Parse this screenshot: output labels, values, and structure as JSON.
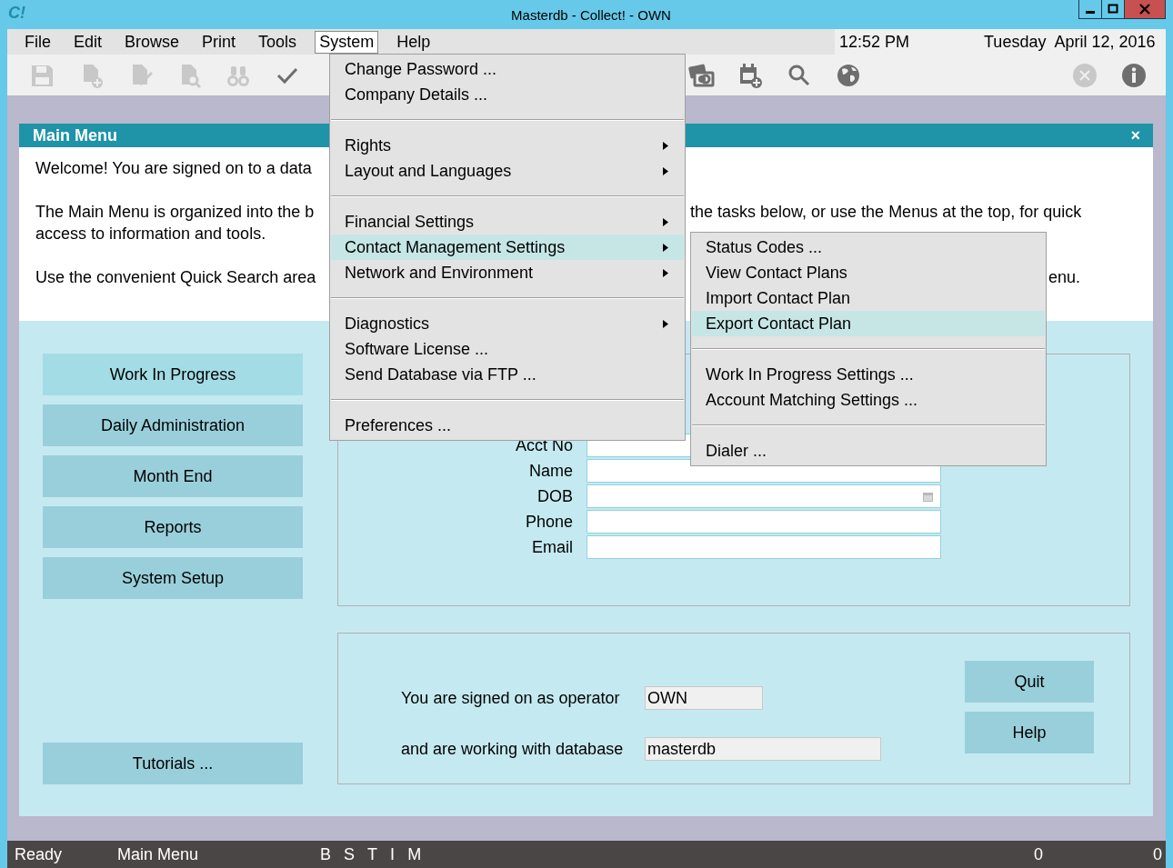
{
  "window": {
    "logo": "C!",
    "title": "Masterdb - Collect! - OWN"
  },
  "menu_bar": [
    {
      "label": "File",
      "selected": false
    },
    {
      "label": "Edit",
      "selected": false
    },
    {
      "label": "Browse",
      "selected": false
    },
    {
      "label": "Print",
      "selected": false
    },
    {
      "label": "Tools",
      "selected": false
    },
    {
      "label": "System",
      "selected": true
    },
    {
      "label": "Help",
      "selected": false
    }
  ],
  "clock": {
    "time": "12:52 PM",
    "day": "Tuesday",
    "date": "April 12, 2016"
  },
  "toolbar": [
    {
      "disabled": true
    },
    {
      "disabled": true
    },
    {
      "disabled": true
    },
    {
      "disabled": true
    },
    {
      "disabled": true
    },
    {
      "disabled": false
    },
    {
      "disabled": false
    },
    {
      "disabled": false
    },
    {
      "disabled": false
    },
    {
      "disabled": false
    },
    {
      "disabled": true
    },
    {
      "disabled": false
    }
  ],
  "main_menu": {
    "title": "Main Menu",
    "close": "×",
    "intro": [
      {
        "lines": [
          {
            "text": "Welcome! You are signed on to a data"
          }
        ]
      },
      {
        "lines": [
          {
            "text": "The Main Menu is organized into the b",
            "continued": "the tasks below, or use the Menus at the top, for quick"
          },
          {
            "text": "access to information and tools."
          }
        ]
      },
      {
        "lines": [
          {
            "text": "Use the convenient Quick Search area",
            "continued": "enu."
          }
        ]
      }
    ],
    "nav_buttons": [
      {
        "label": "Work In Progress",
        "hovered": true
      },
      {
        "label": "Daily Administration",
        "hovered": false
      },
      {
        "label": "Month End",
        "hovered": false
      },
      {
        "label": "Reports",
        "hovered": false
      },
      {
        "label": "System Setup",
        "hovered": false
      }
    ],
    "tutorials": {
      "label": "Tutorials ...",
      "hovered": false
    },
    "quick_search": {
      "fields": [
        {
          "label": "Acct No",
          "kind": "text"
        },
        {
          "label": "Name",
          "kind": "text"
        },
        {
          "label": "DOB",
          "kind": "date"
        },
        {
          "label": "Phone",
          "kind": "text"
        },
        {
          "label": "Email",
          "kind": "text"
        }
      ]
    },
    "session": {
      "operator_label": "You are signed on as operator",
      "operator": "OWN",
      "database_label": "and are working with database",
      "database": "masterdb"
    },
    "actions": [
      {
        "label": "Quit"
      },
      {
        "label": "Help"
      }
    ]
  },
  "status_bar": {
    "status": "Ready",
    "view": "Main Menu",
    "indicators": [
      "B",
      "S",
      "T",
      "I",
      "M"
    ],
    "counts": [
      "0",
      "0"
    ]
  },
  "system_menu": {
    "groups": [
      {
        "items": [
          {
            "label": "Change Password ...",
            "has_submenu": false,
            "selected": false
          },
          {
            "label": "Company Details ...",
            "has_submenu": false,
            "selected": false
          }
        ]
      },
      {
        "items": [
          {
            "label": "Rights",
            "has_submenu": true,
            "selected": false
          },
          {
            "label": "Layout and Languages",
            "has_submenu": true,
            "selected": false
          }
        ]
      },
      {
        "items": [
          {
            "label": "Financial Settings",
            "has_submenu": true,
            "selected": false
          },
          {
            "label": "Contact Management Settings",
            "has_submenu": true,
            "selected": true
          },
          {
            "label": "Network and Environment",
            "has_submenu": true,
            "selected": false
          }
        ]
      },
      {
        "items": [
          {
            "label": "Diagnostics",
            "has_submenu": true,
            "selected": false
          },
          {
            "label": "Software License ...",
            "has_submenu": false,
            "selected": false
          },
          {
            "label": "Send Database via FTP ...",
            "has_submenu": false,
            "selected": false
          }
        ]
      },
      {
        "items": [
          {
            "label": "Preferences ...",
            "has_submenu": false,
            "selected": false
          }
        ]
      }
    ]
  },
  "contact_submenu": {
    "groups": [
      {
        "items": [
          {
            "label": "Status Codes ...",
            "has_submenu": false,
            "selected": false
          },
          {
            "label": "View Contact Plans",
            "has_submenu": false,
            "selected": false
          },
          {
            "label": "Import Contact Plan",
            "has_submenu": false,
            "selected": false
          },
          {
            "label": "Export Contact Plan",
            "has_submenu": false,
            "selected": true
          }
        ]
      },
      {
        "items": [
          {
            "label": "Work In Progress Settings ...",
            "has_submenu": false,
            "selected": false
          },
          {
            "label": "Account Matching Settings ...",
            "has_submenu": false,
            "selected": false
          }
        ]
      },
      {
        "items": [
          {
            "label": "Dialer ...",
            "has_submenu": false,
            "selected": false
          }
        ]
      }
    ]
  }
}
